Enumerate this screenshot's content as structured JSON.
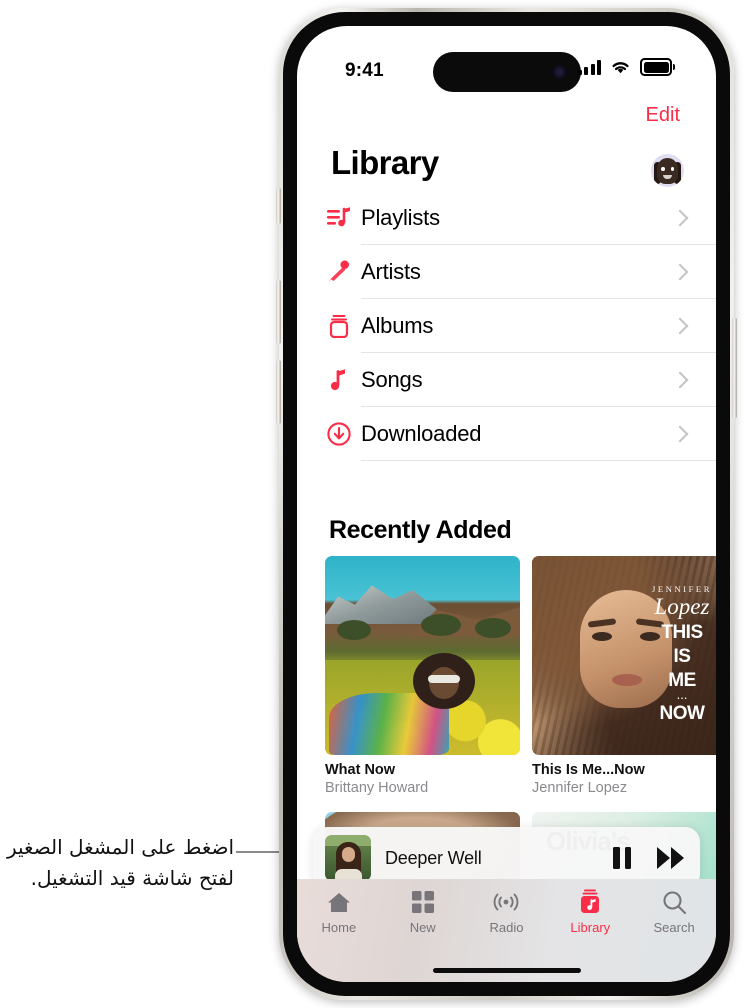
{
  "callout": {
    "text": "اضغط على المشغل الصغير لفتح شاشة قيد التشغيل."
  },
  "statusbar": {
    "time": "9:41",
    "signal_icon": "cellular-bars-icon",
    "wifi_icon": "wifi-icon",
    "battery_icon": "battery-icon"
  },
  "nav": {
    "edit_label": "Edit",
    "title": "Library",
    "avatar_name": "user-avatar"
  },
  "list": {
    "items": [
      {
        "label": "Playlists",
        "icon": "playlist-icon"
      },
      {
        "label": "Artists",
        "icon": "microphone-icon"
      },
      {
        "label": "Albums",
        "icon": "albums-icon"
      },
      {
        "label": "Songs",
        "icon": "music-note-icon"
      },
      {
        "label": "Downloaded",
        "icon": "download-circle-icon"
      }
    ]
  },
  "recently_added": {
    "heading": "Recently Added",
    "albums": [
      {
        "title": "What Now",
        "artist": "Brittany Howard"
      },
      {
        "title": "This Is Me...Now",
        "artist": "Jennifer Lopez"
      }
    ],
    "partial_album_text": "Olivia's",
    "jlo_art": {
      "first_name": "JENNIFER",
      "script_name": "Lopez",
      "line1": "THIS",
      "line2": "IS",
      "line3": "ME",
      "dots": "...",
      "line4": "NOW"
    }
  },
  "miniplayer": {
    "track_title": "Deeper Well",
    "pause_icon": "pause-icon",
    "next_icon": "fast-forward-icon"
  },
  "tabbar": {
    "tabs": [
      {
        "label": "Home",
        "icon": "home-icon",
        "active": false
      },
      {
        "label": "New",
        "icon": "grid-icon",
        "active": false
      },
      {
        "label": "Radio",
        "icon": "radio-icon",
        "active": false
      },
      {
        "label": "Library",
        "icon": "library-icon",
        "active": true
      },
      {
        "label": "Search",
        "icon": "search-icon",
        "active": false
      }
    ]
  },
  "colors": {
    "accent_red": "#fa2d48",
    "inactive_gray": "#77757a",
    "separator": "#e4e4e6"
  }
}
